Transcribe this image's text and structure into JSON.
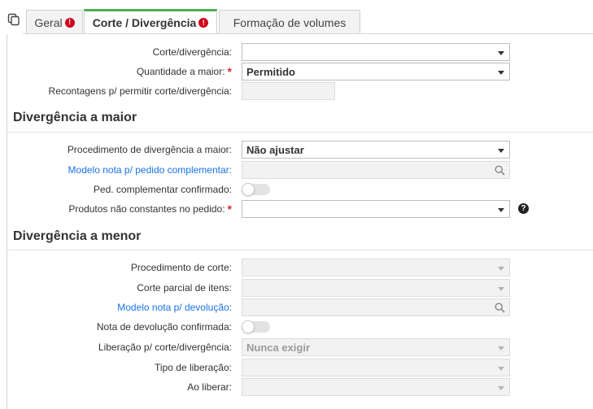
{
  "tabs": [
    {
      "label": "Geral",
      "error": "!"
    },
    {
      "label": "Corte / Divergência",
      "error": "!"
    },
    {
      "label": "Formação de volumes"
    }
  ],
  "corte": {
    "corte_divergencia": {
      "label": "Corte/divergência:",
      "value": ""
    },
    "quantidade_maior": {
      "label": "Quantidade a maior:",
      "required": "*",
      "value": "Permitido"
    },
    "recontagens": {
      "label": "Recontagens p/ permitir corte/divergência:",
      "value": ""
    }
  },
  "divergencia_maior": {
    "title": "Divergência a maior",
    "procedimento": {
      "label": "Procedimento de divergência a maior:",
      "value": "Não ajustar"
    },
    "modelo_nota": {
      "label": "Modelo nota p/ pedido complementar:",
      "value": ""
    },
    "ped_confirmado": {
      "label": "Ped. complementar confirmado:",
      "checked": false
    },
    "produtos_nao_constantes": {
      "label": "Produtos não constantes no pedido:",
      "required": "*",
      "value": ""
    },
    "help_icon": "?"
  },
  "divergencia_menor": {
    "title": "Divergência a menor",
    "procedimento_corte": {
      "label": "Procedimento de corte:",
      "value": ""
    },
    "corte_parcial": {
      "label": "Corte parcial de itens:",
      "value": ""
    },
    "modelo_nota_devolucao": {
      "label": "Modelo nota p/ devolução:",
      "value": ""
    },
    "nota_devolucao_confirmada": {
      "label": "Nota de devolução confirmada:",
      "checked": false
    },
    "liberacao": {
      "label": "Liberação p/ corte/divergência:",
      "value": "Nunca exigir"
    },
    "tipo_liberacao": {
      "label": "Tipo de liberação:",
      "value": ""
    },
    "ao_liberar": {
      "label": "Ao liberar:",
      "value": ""
    }
  },
  "colors": {
    "active_tab_accent": "#4caf50",
    "required": "#d32f2f",
    "link": "#1a73e8",
    "error_badge": "#d0021b"
  }
}
